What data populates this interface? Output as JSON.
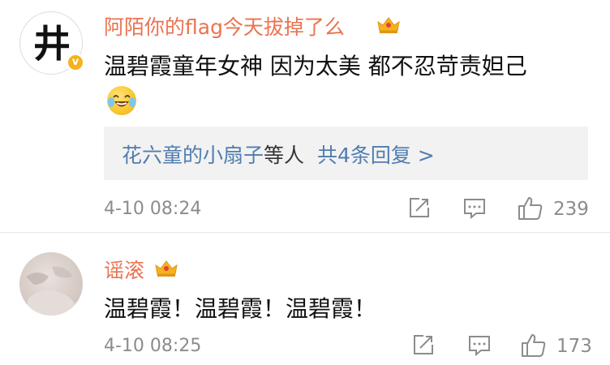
{
  "comments": [
    {
      "username": "阿陌你的flag今天拔掉了么",
      "avatar_text": "井",
      "verified_mark": "v",
      "text": "温碧霞童年女神 因为太美 都不忍苛责妲己",
      "emoji": "laugh-cry-emoji",
      "replies": {
        "from": "花六童的小扇子",
        "suffix": "等人",
        "total": "共4条回复 >"
      },
      "time": "4-10 08:24",
      "likes": "239"
    },
    {
      "username": "谣滚",
      "text": "温碧霞！温碧霞！温碧霞！",
      "time": "4-10 08:25",
      "likes": "173"
    }
  ],
  "colors": {
    "username": "#eb7350",
    "link": "#507daf",
    "meta": "#8c8c8c",
    "reply_bg": "#f2f2f2",
    "crown": "#f6b21b"
  }
}
